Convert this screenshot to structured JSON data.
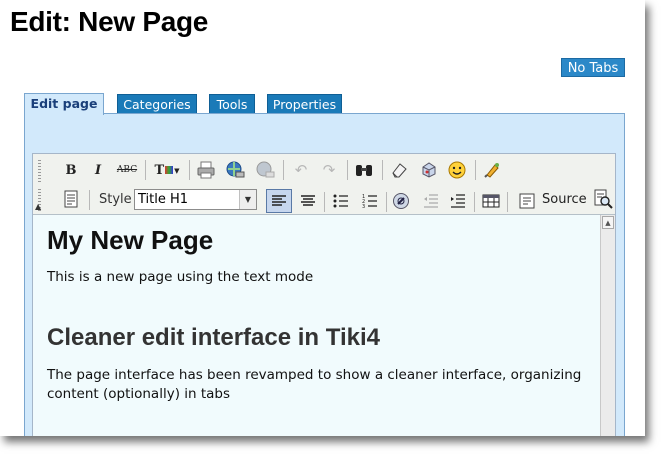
{
  "page": {
    "title": "Edit: New Page",
    "no_tabs_label": "No Tabs"
  },
  "tabs": [
    {
      "label": "Edit page",
      "active": true
    },
    {
      "label": "Categories",
      "active": false
    },
    {
      "label": "Tools",
      "active": false
    },
    {
      "label": "Properties",
      "active": false
    }
  ],
  "toolbar": {
    "row1": [
      "bold-icon",
      "italic-icon",
      "strikethrough-icon",
      "text-color-icon",
      "print-icon",
      "link-icon",
      "unlink-icon",
      "undo-icon",
      "redo-icon",
      "find-icon",
      "eraser-icon",
      "special-chars-icon",
      "smiley-icon",
      "plugin-icon"
    ],
    "style_label": "Style",
    "style_value": "Title H1",
    "source_label": "Source",
    "row2": [
      "templates-icon",
      "align-left-icon",
      "align-center-icon",
      "bullet-list-icon",
      "numbered-list-icon",
      "link-browse-icon",
      "outdent-icon",
      "indent-icon",
      "table-icon",
      "source-icon",
      "find-replace-icon"
    ]
  },
  "content": {
    "heading1": "My New Page",
    "para1": "This is a new page using the text mode",
    "heading2": "Cleaner edit interface in Tiki4",
    "para2": "The page interface has been revamped to show a cleaner interface, organizing content (optionally) in tabs"
  },
  "colors": {
    "tab_bg": "#1a7ab8",
    "panel_bg": "#d2e9fb",
    "button_bg": "#2b88c8",
    "editor_bg": "#f1fbfd"
  }
}
